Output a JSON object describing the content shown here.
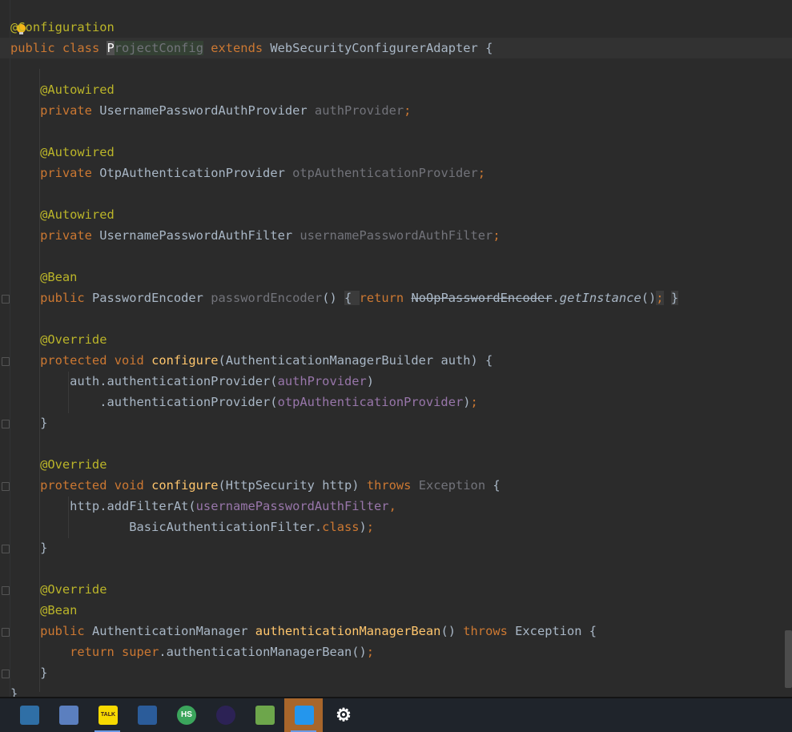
{
  "editor": {
    "lines": [
      {
        "tokens": [
          {
            "t": "@",
            "c": "ann"
          },
          {
            "t": "Configuration",
            "c": "ann"
          }
        ]
      },
      {
        "tokens": [
          {
            "t": "public ",
            "c": "kw"
          },
          {
            "t": "class ",
            "c": "kw"
          },
          {
            "t": "P",
            "c": "caret-cell"
          },
          {
            "t": "rojectConfig",
            "c": "unused name-hl"
          },
          {
            "t": " extends ",
            "c": "kw"
          },
          {
            "t": "WebSecurityConfigurerAdapter {",
            "c": ""
          }
        ]
      },
      {
        "tokens": []
      },
      {
        "tokens": [
          {
            "t": "    @Autowired",
            "c": "ann"
          }
        ]
      },
      {
        "tokens": [
          {
            "t": "    private ",
            "c": "kw"
          },
          {
            "t": "UsernamePasswordAuthProvider ",
            "c": ""
          },
          {
            "t": "authProvider",
            "c": "unused"
          },
          {
            "t": ";",
            "c": "kw"
          }
        ]
      },
      {
        "tokens": []
      },
      {
        "tokens": [
          {
            "t": "    @Autowired",
            "c": "ann"
          }
        ]
      },
      {
        "tokens": [
          {
            "t": "    private ",
            "c": "kw"
          },
          {
            "t": "OtpAuthenticationProvider ",
            "c": ""
          },
          {
            "t": "otpAuthenticationProvider",
            "c": "unused"
          },
          {
            "t": ";",
            "c": "kw"
          }
        ]
      },
      {
        "tokens": []
      },
      {
        "tokens": [
          {
            "t": "    @Autowired",
            "c": "ann"
          }
        ]
      },
      {
        "tokens": [
          {
            "t": "    private ",
            "c": "kw"
          },
          {
            "t": "UsernamePasswordAuthFilter ",
            "c": ""
          },
          {
            "t": "usernamePasswordAuthFilter",
            "c": "unused"
          },
          {
            "t": ";",
            "c": "kw"
          }
        ]
      },
      {
        "tokens": []
      },
      {
        "tokens": [
          {
            "t": "    @Bean",
            "c": "ann"
          }
        ]
      },
      {
        "tokens": [
          {
            "t": "    public ",
            "c": "kw"
          },
          {
            "t": "PasswordEncoder ",
            "c": ""
          },
          {
            "t": "passwordEncoder",
            "c": "unused"
          },
          {
            "t": "()",
            "c": ""
          },
          {
            "t": " ",
            "c": ""
          },
          {
            "t": "{ ",
            "c": "fold-bg"
          },
          {
            "t": "return ",
            "c": "kw"
          },
          {
            "t": "NoOpPasswordEncoder",
            "c": "strike"
          },
          {
            "t": ".",
            "c": ""
          },
          {
            "t": "getInstance",
            "c": "ital"
          },
          {
            "t": "()",
            "c": ""
          },
          {
            "t": ";",
            "c": "kw fold-bg"
          },
          {
            "t": " ",
            "c": ""
          },
          {
            "t": "}",
            "c": "fold-bg"
          }
        ]
      },
      {
        "tokens": []
      },
      {
        "tokens": [
          {
            "t": "    @Override",
            "c": "ann"
          }
        ]
      },
      {
        "tokens": [
          {
            "t": "    protected ",
            "c": "kw"
          },
          {
            "t": "void ",
            "c": "kw"
          },
          {
            "t": "configure",
            "c": "meth"
          },
          {
            "t": "(AuthenticationManagerBuilder auth) {",
            "c": ""
          }
        ]
      },
      {
        "tokens": [
          {
            "t": "        auth.authenticationProvider(",
            "c": ""
          },
          {
            "t": "authProvider",
            "c": "fld"
          },
          {
            "t": ")",
            "c": ""
          }
        ]
      },
      {
        "tokens": [
          {
            "t": "            .authenticationProvider(",
            "c": ""
          },
          {
            "t": "otpAuthenticationProvider",
            "c": "fld"
          },
          {
            "t": ")",
            "c": ""
          },
          {
            "t": ";",
            "c": "kw"
          }
        ]
      },
      {
        "tokens": [
          {
            "t": "    }",
            "c": ""
          }
        ]
      },
      {
        "tokens": []
      },
      {
        "tokens": [
          {
            "t": "    @Override",
            "c": "ann"
          }
        ]
      },
      {
        "tokens": [
          {
            "t": "    protected ",
            "c": "kw"
          },
          {
            "t": "void ",
            "c": "kw"
          },
          {
            "t": "configure",
            "c": "meth"
          },
          {
            "t": "(HttpSecurity http) ",
            "c": ""
          },
          {
            "t": "throws ",
            "c": "kw"
          },
          {
            "t": "Exception",
            "c": "unused"
          },
          {
            "t": " {",
            "c": ""
          }
        ]
      },
      {
        "tokens": [
          {
            "t": "        http.addFilterAt(",
            "c": ""
          },
          {
            "t": "usernamePasswordAuthFilter",
            "c": "fld"
          },
          {
            "t": ",",
            "c": "kw"
          }
        ]
      },
      {
        "tokens": [
          {
            "t": "                BasicAuthenticationFilter.",
            "c": ""
          },
          {
            "t": "class",
            "c": "kw"
          },
          {
            "t": ")",
            "c": ""
          },
          {
            "t": ";",
            "c": "kw"
          }
        ]
      },
      {
        "tokens": [
          {
            "t": "    }",
            "c": ""
          }
        ]
      },
      {
        "tokens": []
      },
      {
        "tokens": [
          {
            "t": "    @Override",
            "c": "ann"
          }
        ]
      },
      {
        "tokens": [
          {
            "t": "    @Bean",
            "c": "ann"
          }
        ]
      },
      {
        "tokens": [
          {
            "t": "    public ",
            "c": "kw"
          },
          {
            "t": "AuthenticationManager ",
            "c": ""
          },
          {
            "t": "authenticationManagerBean",
            "c": "meth"
          },
          {
            "t": "() ",
            "c": ""
          },
          {
            "t": "throws ",
            "c": "kw"
          },
          {
            "t": "Exception {",
            "c": ""
          }
        ]
      },
      {
        "tokens": [
          {
            "t": "        return ",
            "c": "kw"
          },
          {
            "t": "super",
            "c": "kw"
          },
          {
            "t": ".authenticationManagerBean()",
            "c": ""
          },
          {
            "t": ";",
            "c": "kw"
          }
        ]
      },
      {
        "tokens": [
          {
            "t": "    }",
            "c": ""
          }
        ]
      },
      {
        "tokens": [
          {
            "t": "}",
            "c": ""
          }
        ]
      }
    ]
  },
  "colors": {
    "background": "#2b2b2b",
    "keyword": "#cc7832",
    "annotation": "#bbb529",
    "field": "#9876aa",
    "method": "#ffc66d",
    "text": "#a9b7c6",
    "taskbar": "#1f242b",
    "active_taskbar": "#a8662b"
  },
  "taskbar": {
    "items": [
      {
        "name": "mysql-workbench-icon",
        "active": false,
        "underline": false,
        "color": "#2f6fa6"
      },
      {
        "name": "ssms-icon",
        "active": false,
        "underline": false,
        "color": "#5b7fbf"
      },
      {
        "name": "kakaotalk-icon",
        "active": false,
        "underline": true,
        "color": "#f7d900",
        "label": "TALK"
      },
      {
        "name": "virtualbox-icon",
        "active": false,
        "underline": false,
        "color": "#2b5c9a"
      },
      {
        "name": "heidisql-icon",
        "active": false,
        "underline": false,
        "color": "#3ba55c",
        "label": "HS"
      },
      {
        "name": "eclipse-icon",
        "active": false,
        "underline": false,
        "color": "#2c2255"
      },
      {
        "name": "visual-studio-icon",
        "active": false,
        "underline": false,
        "color": "#6da64b"
      },
      {
        "name": "docker-icon",
        "active": true,
        "underline": true,
        "color": "#2496ed"
      },
      {
        "name": "settings-gear-icon",
        "active": false,
        "underline": false,
        "color": "#e8e8e8",
        "label": "⚙"
      }
    ]
  }
}
